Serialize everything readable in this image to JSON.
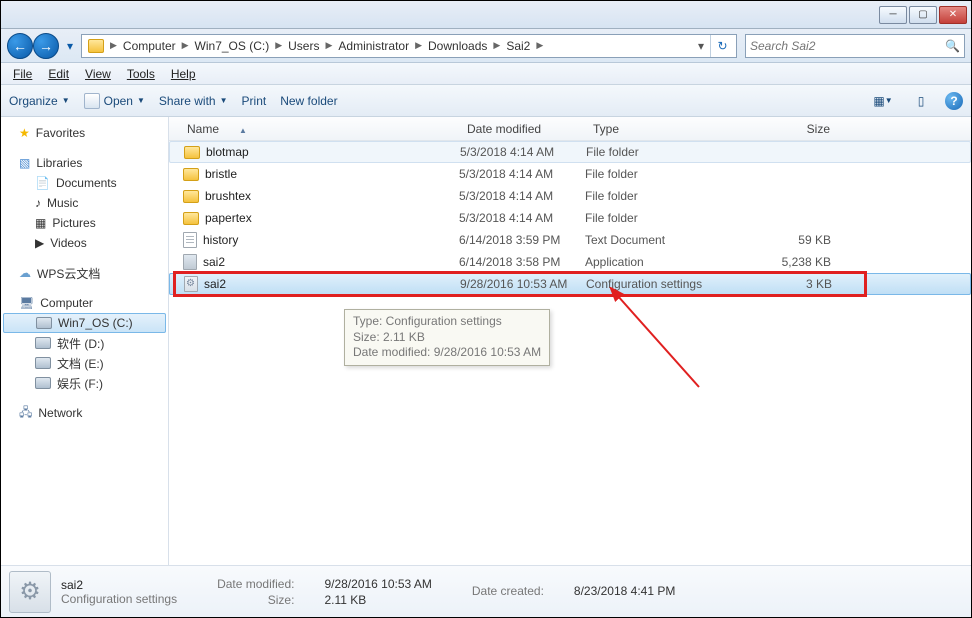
{
  "titlebar": {
    "min": "─",
    "max": "▢",
    "close": "✕"
  },
  "nav": {
    "crumbs": [
      "Computer",
      "Win7_OS (C:)",
      "Users",
      "Administrator",
      "Downloads",
      "Sai2"
    ],
    "search_placeholder": "Search Sai2"
  },
  "menubar": [
    "File",
    "Edit",
    "View",
    "Tools",
    "Help"
  ],
  "toolbar": {
    "organize": "Organize",
    "open": "Open",
    "share": "Share with",
    "print": "Print",
    "newfolder": "New folder"
  },
  "navpane": {
    "favorites": "Favorites",
    "libraries": "Libraries",
    "lib_items": [
      "Documents",
      "Music",
      "Pictures",
      "Videos"
    ],
    "wps": "WPS云文档",
    "computer": "Computer",
    "drives": [
      "Win7_OS (C:)",
      "软件 (D:)",
      "文档 (E:)",
      "娱乐 (F:)"
    ],
    "network": "Network"
  },
  "columns": {
    "name": "Name",
    "date": "Date modified",
    "type": "Type",
    "size": "Size"
  },
  "files": [
    {
      "name": "blotmap",
      "date": "5/3/2018 4:14 AM",
      "type": "File folder",
      "size": "",
      "icon": "folder",
      "sel": "light"
    },
    {
      "name": "bristle",
      "date": "5/3/2018 4:14 AM",
      "type": "File folder",
      "size": "",
      "icon": "folder"
    },
    {
      "name": "brushtex",
      "date": "5/3/2018 4:14 AM",
      "type": "File folder",
      "size": "",
      "icon": "folder"
    },
    {
      "name": "papertex",
      "date": "5/3/2018 4:14 AM",
      "type": "File folder",
      "size": "",
      "icon": "folder"
    },
    {
      "name": "history",
      "date": "6/14/2018 3:59 PM",
      "type": "Text Document",
      "size": "59 KB",
      "icon": "txt"
    },
    {
      "name": "sai2",
      "date": "6/14/2018 3:58 PM",
      "type": "Application",
      "size": "5,238 KB",
      "icon": "app"
    },
    {
      "name": "sai2",
      "date": "9/28/2016 10:53 AM",
      "type": "Configuration settings",
      "size": "3 KB",
      "icon": "cfg",
      "sel": "strong"
    }
  ],
  "tooltip": {
    "line1": "Type: Configuration settings",
    "line2": "Size: 2.11 KB",
    "line3": "Date modified: 9/28/2016 10:53 AM"
  },
  "details": {
    "name": "sai2",
    "type": "Configuration settings",
    "dm_label": "Date modified:",
    "dm_val": "9/28/2016 10:53 AM",
    "dc_label": "Date created:",
    "dc_val": "8/23/2018 4:41 PM",
    "sz_label": "Size:",
    "sz_val": "2.11 KB"
  }
}
